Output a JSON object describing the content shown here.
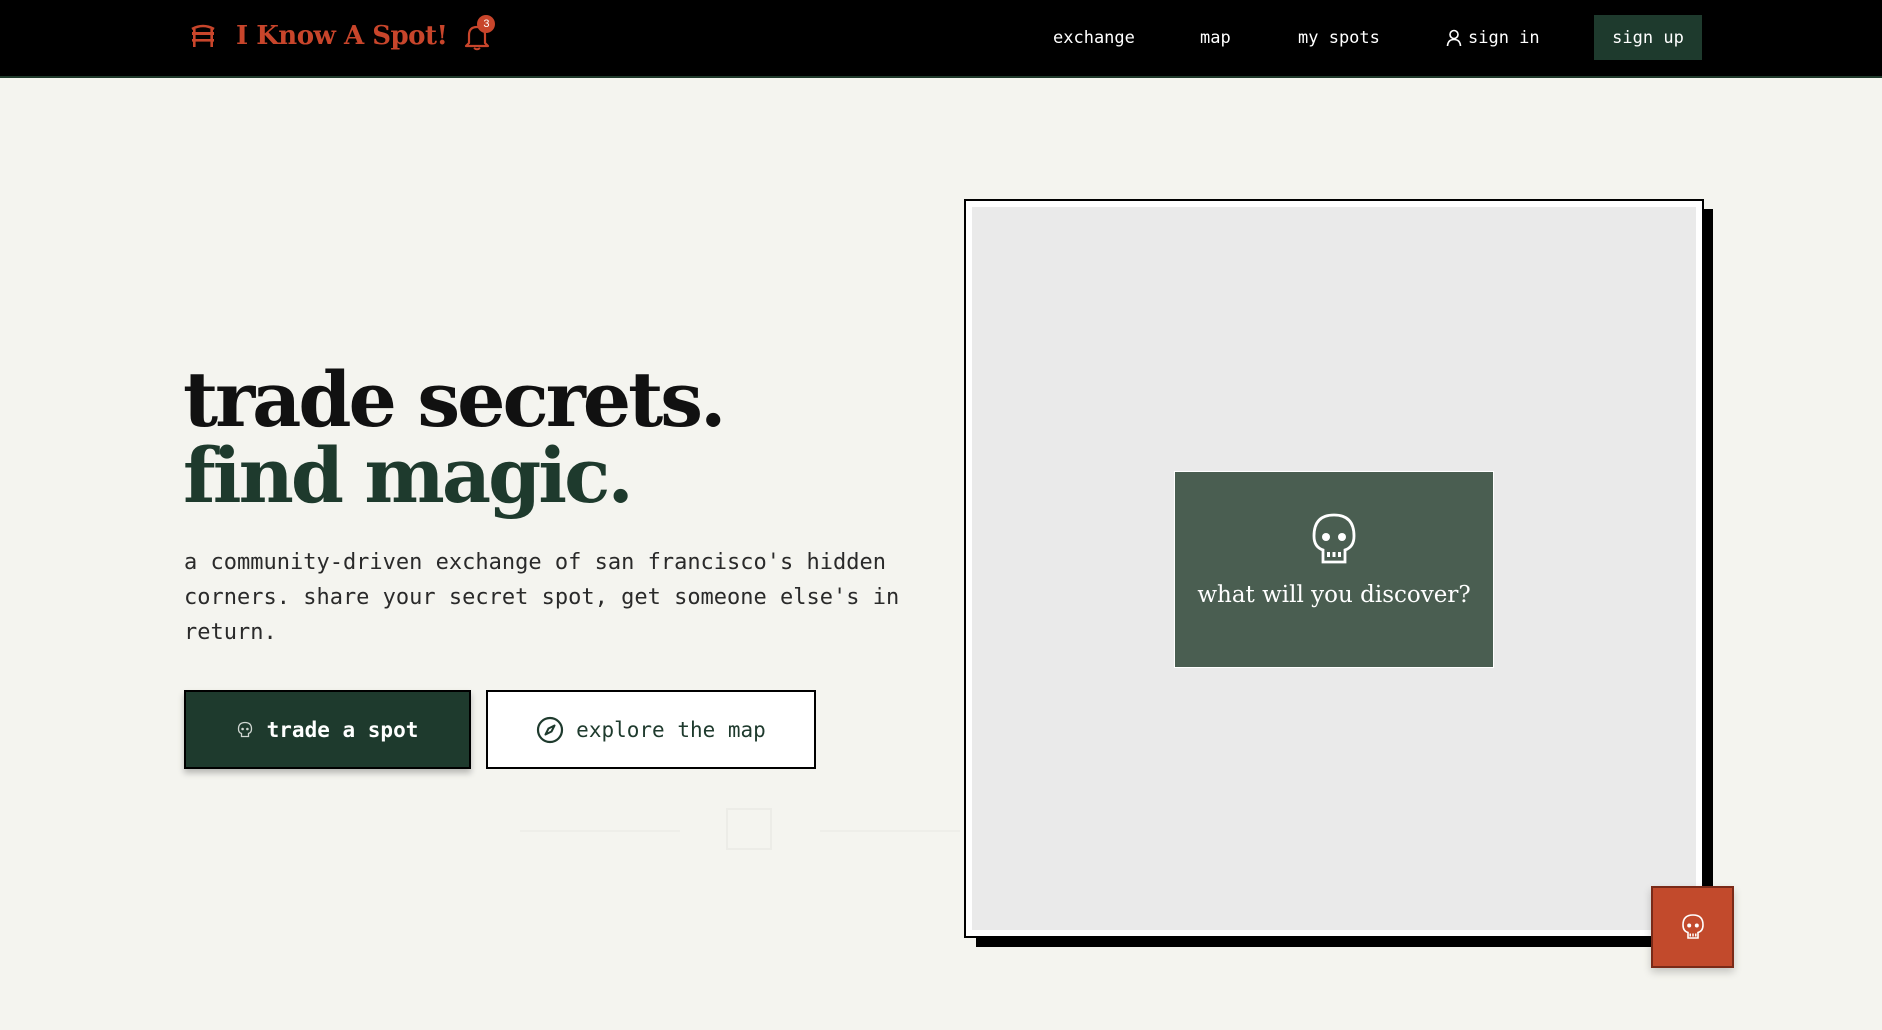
{
  "header": {
    "brand_name": "I Know A Spot!",
    "logo_icon": "bench-icon",
    "notification_count": "3",
    "nav": {
      "exchange": "exchange",
      "map": "map",
      "my_spots": "my spots",
      "sign_in": "sign in",
      "sign_up": "sign up"
    }
  },
  "hero": {
    "title_line1": "trade secrets.",
    "title_line2": "find magic.",
    "description": "a community-driven exchange of san francisco's hidden corners. share your secret spot, get someone else's in return.",
    "primary_button": "trade a spot",
    "secondary_button": "explore the map"
  },
  "card": {
    "prompt": "what will you discover?"
  },
  "colors": {
    "accent": "#c8452b",
    "primary_green": "#1e3a2d",
    "card_green": "#4a5e51",
    "background": "#f4f4ef"
  }
}
